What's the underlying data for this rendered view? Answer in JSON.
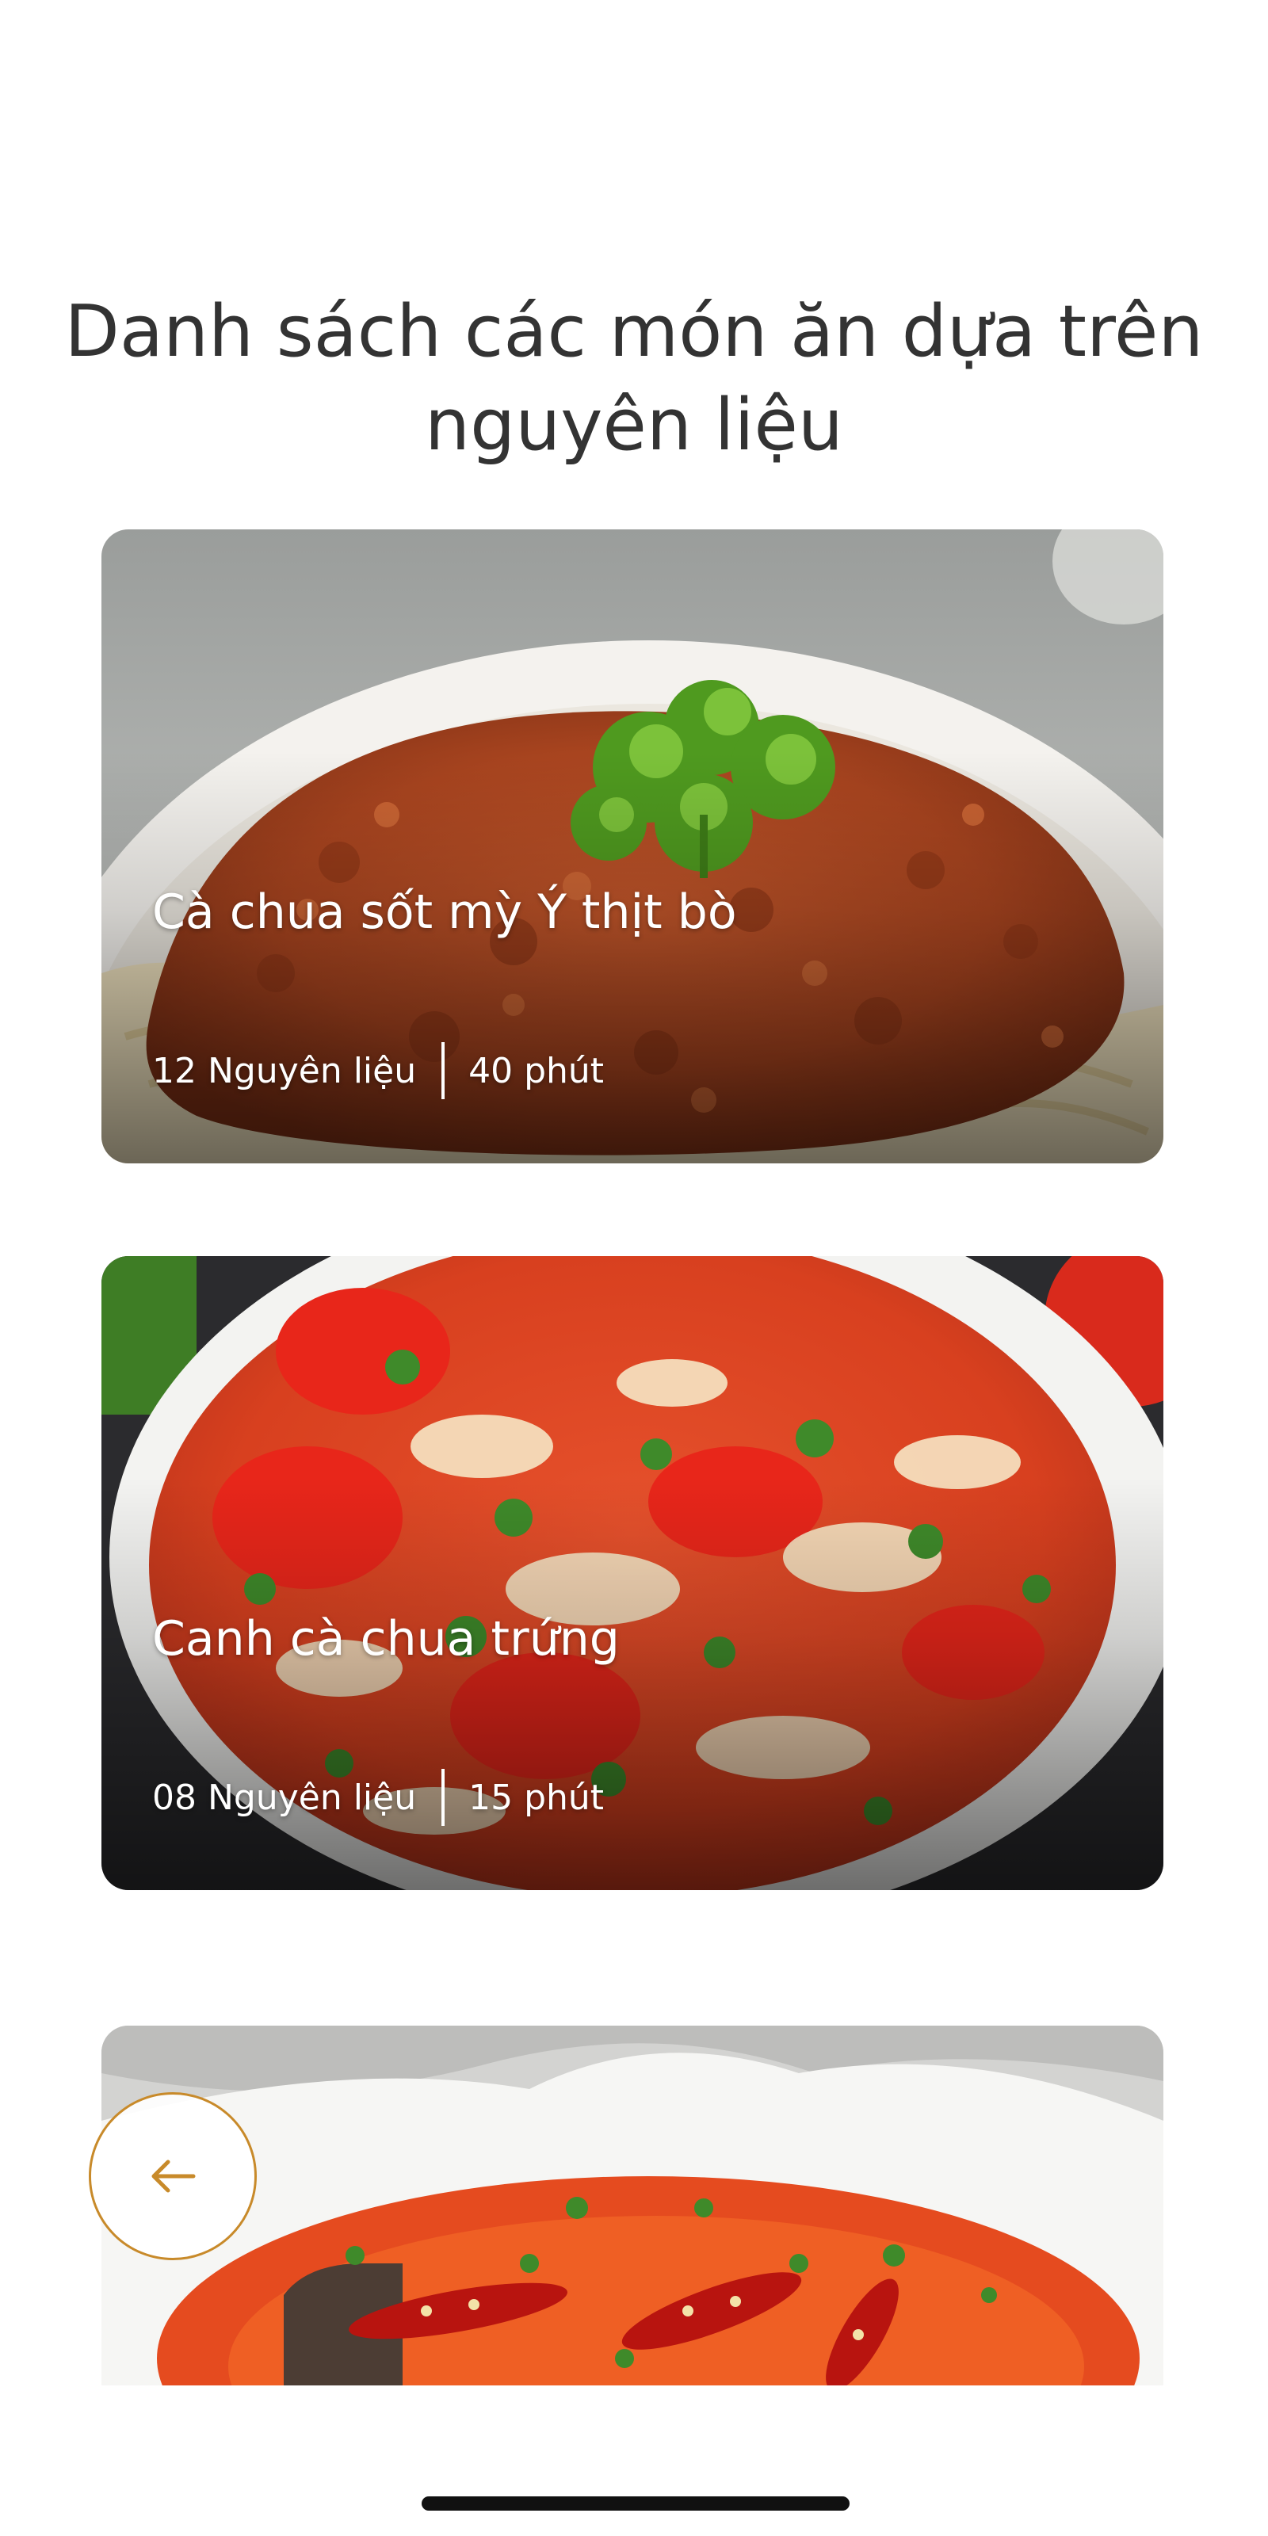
{
  "page": {
    "title": "Danh sách các món ăn dựa trên nguyên liệu"
  },
  "recipes": [
    {
      "name": "Cà chua sốt mỳ Ý thịt bò",
      "ingredients": "12 Nguyên liệu",
      "time": "40 phút"
    },
    {
      "name": "Canh cà chua trứng",
      "ingredients": "08 Nguyên liệu",
      "time": "15 phút"
    },
    {
      "name": "",
      "ingredients": "",
      "time": ""
    }
  ],
  "icons": {
    "back": "arrow-left-icon"
  },
  "colors": {
    "accent": "#c88a2a",
    "title_text": "#333333",
    "card_text": "#ffffff",
    "home_indicator": "#111111"
  }
}
